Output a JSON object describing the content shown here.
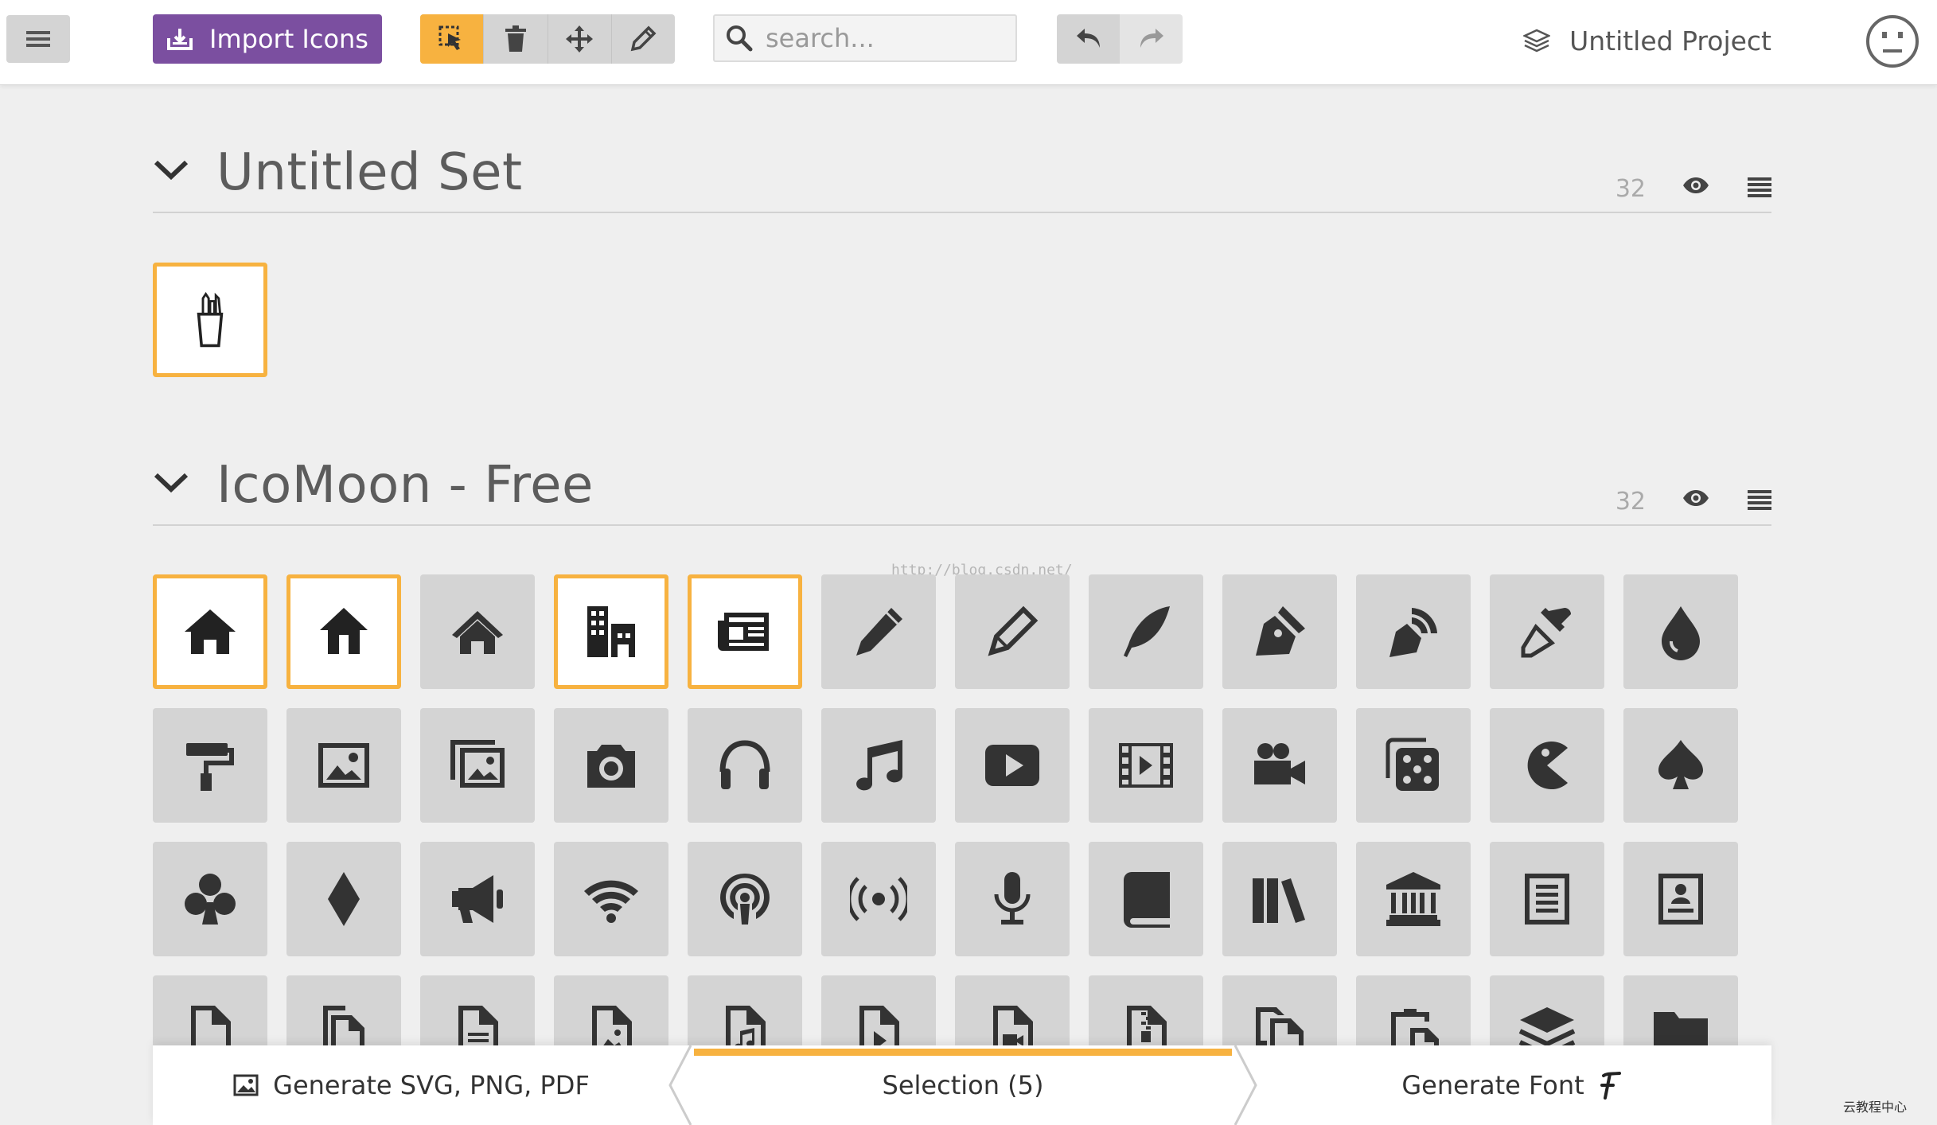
{
  "toolbar": {
    "menu_icon": "hamburger-icon",
    "import_label": "Import Icons",
    "import_color": "#7b4fa0",
    "tools": [
      "select-icon",
      "trash-icon",
      "move-icon",
      "pencil-icon"
    ],
    "active_tool": "select-icon",
    "accent": "#f7b240",
    "search_placeholder": "search...",
    "undo_icon": "undo-icon",
    "redo_icon": "redo-icon"
  },
  "project": {
    "name": "Untitled Project",
    "icon": "layers-icon"
  },
  "sets": [
    {
      "title": "Untitled Set",
      "count": "32",
      "icons": [
        {
          "name": "pencil-cup-icon",
          "selected": true
        }
      ]
    },
    {
      "title": "IcoMoon - Free",
      "count": "32",
      "icons": [
        {
          "name": "home-icon",
          "selected": true
        },
        {
          "name": "home2-icon",
          "selected": true
        },
        {
          "name": "home3-icon",
          "selected": false
        },
        {
          "name": "office-icon",
          "selected": true
        },
        {
          "name": "newspaper-icon",
          "selected": true
        },
        {
          "name": "pencil-icon",
          "selected": false
        },
        {
          "name": "pencil2-icon",
          "selected": false
        },
        {
          "name": "quill-icon",
          "selected": false
        },
        {
          "name": "pen-icon",
          "selected": false
        },
        {
          "name": "blog-icon",
          "selected": false
        },
        {
          "name": "eyedropper-icon",
          "selected": false
        },
        {
          "name": "droplet-icon",
          "selected": false
        },
        {
          "name": "paint-roller-icon",
          "selected": false
        },
        {
          "name": "image-icon",
          "selected": false
        },
        {
          "name": "images-icon",
          "selected": false
        },
        {
          "name": "camera-icon",
          "selected": false
        },
        {
          "name": "headphones-icon",
          "selected": false
        },
        {
          "name": "music-icon",
          "selected": false
        },
        {
          "name": "play-icon",
          "selected": false
        },
        {
          "name": "film-icon",
          "selected": false
        },
        {
          "name": "video-camera-icon",
          "selected": false
        },
        {
          "name": "dice-icon",
          "selected": false
        },
        {
          "name": "pacman-icon",
          "selected": false
        },
        {
          "name": "spades-icon",
          "selected": false
        },
        {
          "name": "clubs-icon",
          "selected": false
        },
        {
          "name": "diamonds-icon",
          "selected": false
        },
        {
          "name": "bullhorn-icon",
          "selected": false
        },
        {
          "name": "wifi-icon",
          "selected": false
        },
        {
          "name": "podcast-icon",
          "selected": false
        },
        {
          "name": "feed-icon",
          "selected": false
        },
        {
          "name": "mic-icon",
          "selected": false
        },
        {
          "name": "book-icon",
          "selected": false
        },
        {
          "name": "books-icon",
          "selected": false
        },
        {
          "name": "library-icon",
          "selected": false
        },
        {
          "name": "file-text-icon",
          "selected": false
        },
        {
          "name": "profile-icon",
          "selected": false
        },
        {
          "name": "file-empty-icon",
          "selected": false
        },
        {
          "name": "files-empty-icon",
          "selected": false
        },
        {
          "name": "file-text2-icon",
          "selected": false
        },
        {
          "name": "file-picture-icon",
          "selected": false
        },
        {
          "name": "file-music-icon",
          "selected": false
        },
        {
          "name": "file-play-icon",
          "selected": false
        },
        {
          "name": "file-video-icon",
          "selected": false
        },
        {
          "name": "file-zip-icon",
          "selected": false
        },
        {
          "name": "copy-icon",
          "selected": false
        },
        {
          "name": "paste-icon",
          "selected": false
        },
        {
          "name": "stack-icon",
          "selected": false
        },
        {
          "name": "folder-icon",
          "selected": false
        }
      ]
    }
  ],
  "watermark": "http://blog.csdn.net/",
  "bottom": {
    "generate_svg_label": "Generate SVG, PNG, PDF",
    "selection_label": "Selection (5)",
    "generate_font_label": "Generate Font",
    "corner_mark": "云教程中心"
  }
}
